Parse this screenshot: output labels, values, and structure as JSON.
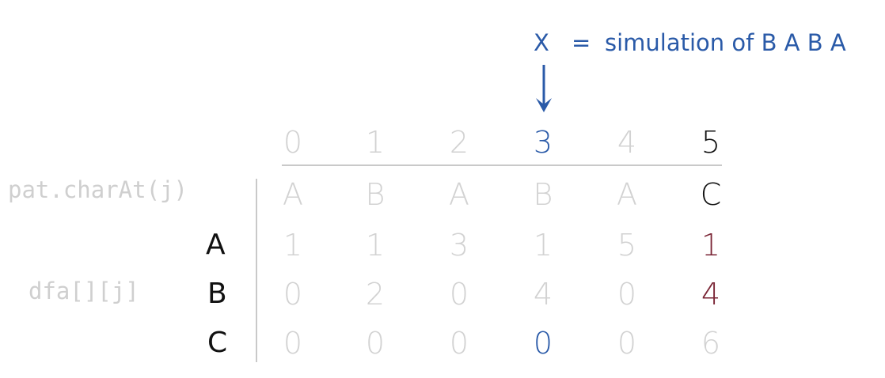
{
  "colors": {
    "faded": "#d2d2d2",
    "label_faded": "#cfcfcf",
    "black": "#111111",
    "blue": "#2a5aa8",
    "red": "#7a2535",
    "rule": "#c9c9c9"
  },
  "annotation": {
    "x_symbol": "X",
    "equals": "=",
    "text": "simulation of B A B A"
  },
  "labels": {
    "pattern_row": "pat.charAt(j)",
    "dfa_label": "dfa[][j]"
  },
  "row_letters": [
    "A",
    "B",
    "C"
  ],
  "states": [
    "0",
    "1",
    "2",
    "3",
    "4",
    "5"
  ],
  "pattern": [
    "A",
    "B",
    "A",
    "B",
    "A",
    "C"
  ],
  "dfa": {
    "A": [
      "1",
      "1",
      "3",
      "1",
      "5",
      "1"
    ],
    "B": [
      "0",
      "2",
      "0",
      "4",
      "0",
      "4"
    ],
    "C": [
      "0",
      "0",
      "0",
      "0",
      "0",
      "6"
    ]
  }
}
